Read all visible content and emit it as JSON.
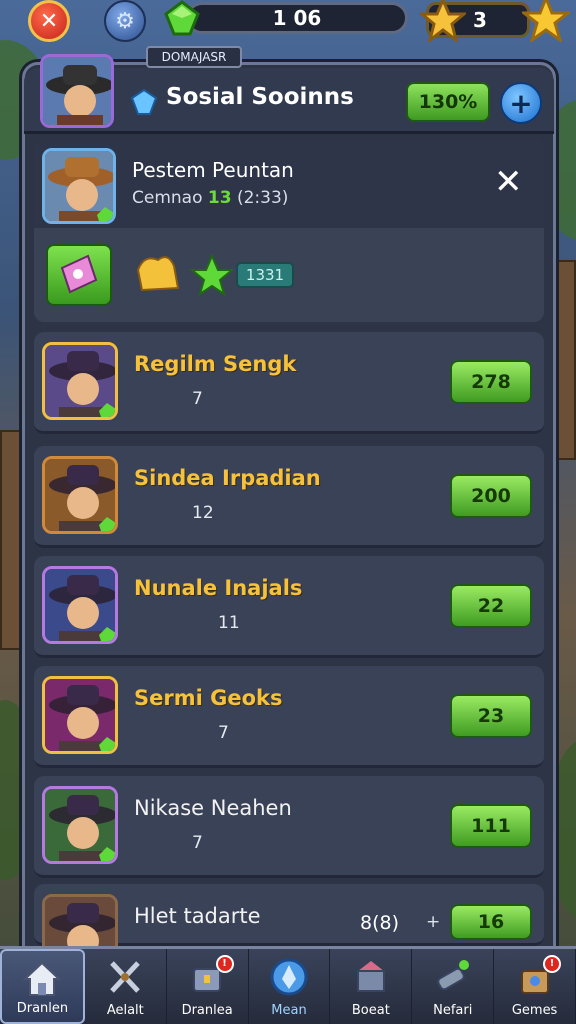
{
  "topbar": {
    "coins": "1 06",
    "stars": "3"
  },
  "panel": {
    "tag": "DOMAJASR",
    "title": "Sosial Sooinns",
    "percent_button": "130%",
    "plus_label": "+"
  },
  "featured": {
    "name": "Pestem Peuntan",
    "sub_prefix": "Cemnao",
    "sub_level": "13",
    "sub_suffix": "(2:33)",
    "count": "1331",
    "close_label": "✕"
  },
  "rows": [
    {
      "name": "Regilm Sengk",
      "level": "7",
      "value": "278",
      "stars": [
        "#b45ee0",
        "#b45ee0"
      ],
      "avatar_color": "#5a4a8a",
      "border": "#f0c040"
    },
    {
      "name": "Sindea Irpadian",
      "level": "12",
      "value": "200",
      "stars": [
        "#f3c23a",
        "#c45ee0"
      ],
      "avatar_color": "#8a5a2a",
      "border": "#d08a3a"
    },
    {
      "name": "Nunale Inajals",
      "level": "11",
      "value": "22",
      "stars": [
        "#f3c23a",
        "#f3c23a",
        "#f3c23a"
      ],
      "avatar_color": "#3a4a8a",
      "border": "#b47ae0"
    },
    {
      "name": "Sermi Geoks",
      "level": "7",
      "value": "23",
      "stars": [
        "#3ccf5a",
        "#e0b08a",
        "#4aa8e8"
      ],
      "avatar_color": "#7a2a6a",
      "border": "#f0c040"
    },
    {
      "name": "Nikase Neahen",
      "level": "7",
      "value": "111",
      "stars": [
        "#3ccf5a",
        "#e04a2a"
      ],
      "avatar_color": "#3a6a3a",
      "border": "#b47ae0"
    },
    {
      "name": "Hlet tadarte",
      "level": "",
      "value": "16",
      "extra": "8(8)",
      "extra_plus": "+",
      "stars": [
        "#f3c23a",
        "#f3c23a"
      ],
      "avatar_color": "#6a4a3a",
      "border": "#8a6a4a"
    }
  ],
  "nav": [
    {
      "label": "Dranlen",
      "icon": "home-icon",
      "active": true
    },
    {
      "label": "Aelalt",
      "icon": "swords-icon",
      "active": false
    },
    {
      "label": "Dranlea",
      "icon": "chest-icon",
      "active": false,
      "badge": "!"
    },
    {
      "label": "Mean",
      "icon": "crest-icon",
      "active": false,
      "blue": true
    },
    {
      "label": "Boeat",
      "icon": "mail-icon",
      "active": false
    },
    {
      "label": "Nefari",
      "icon": "cannon-icon",
      "active": false
    },
    {
      "label": "Gemes",
      "icon": "gift-icon",
      "active": false,
      "badge": "!"
    }
  ],
  "colors": {
    "green_button": "#5cc22e",
    "gold_text": "#f6c23c",
    "panel_bg": "#2d3446"
  }
}
